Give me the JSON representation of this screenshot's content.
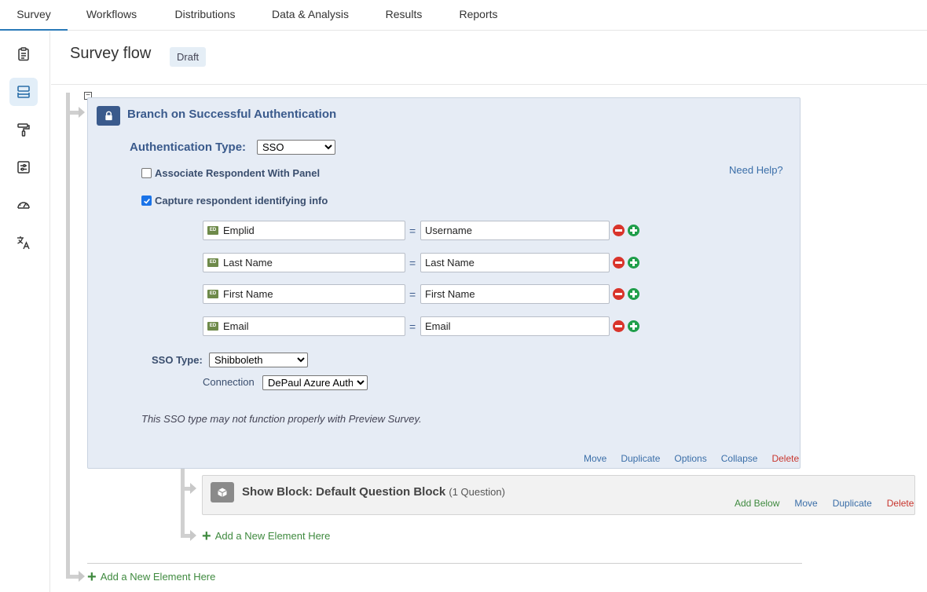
{
  "nav": {
    "tabs": [
      {
        "label": "Survey"
      },
      {
        "label": "Workflows"
      },
      {
        "label": "Distributions"
      },
      {
        "label": "Data & Analysis"
      },
      {
        "label": "Results"
      },
      {
        "label": "Reports"
      }
    ],
    "active_tab": "Survey"
  },
  "rail": {
    "items": [
      {
        "icon": "clipboard-icon"
      },
      {
        "icon": "survey-flow-icon",
        "active": true
      },
      {
        "icon": "paint-roller-icon"
      },
      {
        "icon": "survey-options-icon"
      },
      {
        "icon": "gauge-icon"
      },
      {
        "icon": "translate-icon"
      }
    ]
  },
  "header": {
    "title": "Survey flow",
    "status": "Draft"
  },
  "branch": {
    "title": "Branch on Successful Authentication",
    "auth_type_label": "Authentication Type:",
    "auth_type_value": "SSO",
    "associate_label": "Associate Respondent With Panel",
    "associate_checked": false,
    "capture_label": "Capture respondent identifying info",
    "capture_checked": true,
    "need_help": "Need Help?",
    "mappings": [
      {
        "field": "Emplid",
        "value": "Username"
      },
      {
        "field": "Last Name",
        "value": "Last Name"
      },
      {
        "field": "First Name",
        "value": "First Name"
      },
      {
        "field": "Email",
        "value": "Email"
      }
    ],
    "field_tag": "ED",
    "equals": "=",
    "sso_type_label": "SSO Type:",
    "sso_type_value": "Shibboleth",
    "connection_label": "Connection",
    "connection_value": "DePaul Azure Auth",
    "note": "This SSO type may not function properly with Preview Survey.",
    "actions": {
      "move": "Move",
      "duplicate": "Duplicate",
      "options": "Options",
      "collapse": "Collapse",
      "delete": "Delete"
    }
  },
  "show_block": {
    "title": "Show Block: Default Question Block",
    "subtitle": "(1 Question)",
    "actions": {
      "add_below": "Add Below",
      "move": "Move",
      "duplicate": "Duplicate",
      "delete": "Delete"
    }
  },
  "add_element_inner": "Add a New Element Here",
  "add_element_outer": "Add a New Element Here",
  "colors": {
    "accent": "#2a7ab8",
    "branch_bg": "#e6ecf5",
    "branch_title": "#3a5a8c",
    "delete_red": "#c8362e",
    "add_green": "#3f8a3f"
  }
}
